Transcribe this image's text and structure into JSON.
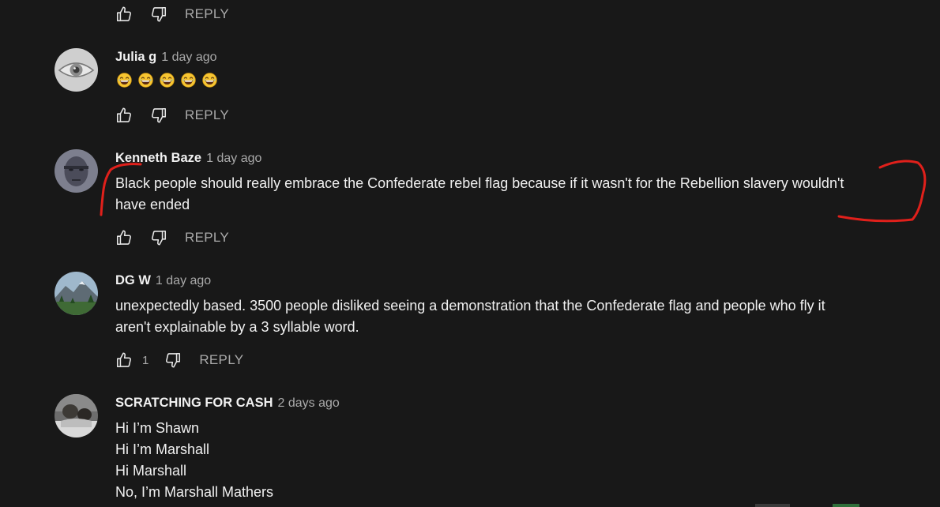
{
  "colors": {
    "background": "#181818",
    "text_primary": "#f1f1f1",
    "text_secondary": "#aaaaaa",
    "annotation_red": "#e0201b"
  },
  "top_actions": {
    "reply_label": "REPLY"
  },
  "comments": [
    {
      "author": "Julia g",
      "time": "1 day ago",
      "avatar_icon": "eye-avatar",
      "emoji": [
        "😂",
        "😂",
        "😂",
        "😂",
        "😂"
      ],
      "reply_label": "REPLY"
    },
    {
      "author": "Kenneth Baze",
      "time": "1 day ago",
      "avatar_icon": "face-avatar",
      "lines": [
        "Black people should really embrace the Confederate rebel flag because if it wasn't for the Rebellion slavery wouldn't",
        "have ended"
      ],
      "reply_label": "REPLY"
    },
    {
      "author": "DG W",
      "time": "1 day ago",
      "avatar_icon": "mountain-avatar",
      "lines": [
        "unexpectedly based. 3500 people disliked seeing a demonstration that the Confederate flag and people who fly it",
        "aren't explainable by a 3 syllable word."
      ],
      "like_count": "1",
      "reply_label": "REPLY"
    },
    {
      "author": "SCRATCHING FOR CASH",
      "time": "2 days ago",
      "avatar_icon": "photo-avatar",
      "lines": [
        "Hi I’m Shawn",
        "Hi I’m Marshall",
        "Hi Marshall",
        "No, I’m Marshall Mathers"
      ]
    }
  ]
}
